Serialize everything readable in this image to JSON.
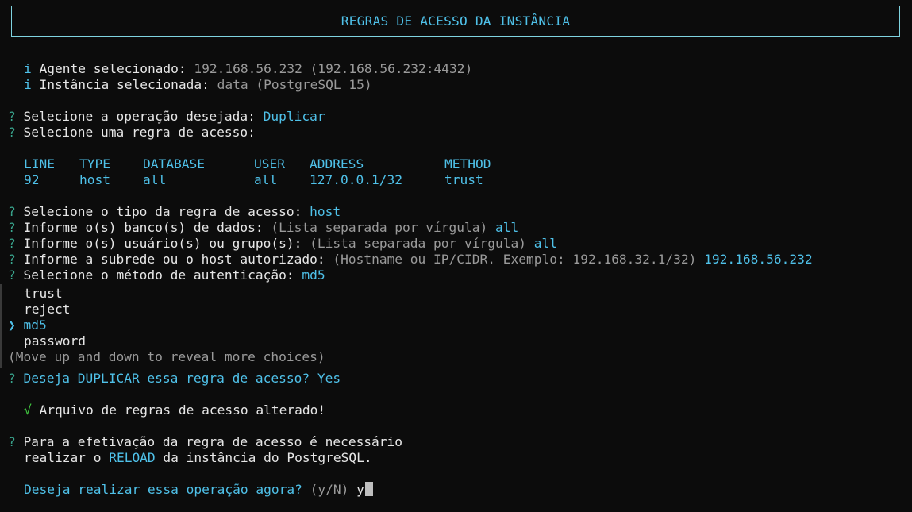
{
  "header": {
    "title": "REGRAS DE ACESSO DA INSTÂNCIA"
  },
  "info": {
    "agent_icon": "i",
    "agent_label": "Agente selecionado:",
    "agent_value": "192.168.56.232 (192.168.56.232:4432)",
    "instance_icon": "i",
    "instance_label": "Instância selecionada:",
    "instance_value": "data (PostgreSQL 15)"
  },
  "prompts": {
    "q_mark": "?",
    "operation_label": "Selecione a operação desejada:",
    "operation_value": "Duplicar",
    "rule_label": "Selecione uma regra de acesso:"
  },
  "table": {
    "columns": [
      "LINE",
      "TYPE",
      "DATABASE",
      "USER",
      "ADDRESS",
      "METHOD"
    ],
    "rows": [
      [
        "92",
        "host",
        "all",
        "all",
        "127.0.0.1/32",
        "trust"
      ]
    ]
  },
  "form": {
    "type_label": "Selecione o tipo da regra de acesso:",
    "type_value": "host",
    "db_label": "Informe o(s) banco(s) de dados:",
    "db_hint": "(Lista separada por vírgula)",
    "db_value": "all",
    "user_label": "Informe o(s) usuário(s) ou grupo(s):",
    "user_hint": "(Lista separada por vírgula)",
    "user_value": "all",
    "host_label": "Informe a subrede ou o host autorizado:",
    "host_hint": "(Hostname ou IP/CIDR. Exemplo: 192.168.32.1/32)",
    "host_value": "192.168.56.232",
    "method_label": "Selecione o método de autenticação:",
    "method_value": "md5"
  },
  "choices": {
    "pointer": "❯",
    "items": [
      "trust",
      "reject",
      "md5",
      "password"
    ],
    "selected_index": 2,
    "hint": "(Move up and down to reveal more choices)"
  },
  "confirm": {
    "duplicate_label": "Deseja DUPLICAR essa regra de acesso?",
    "duplicate_value": "Yes",
    "success_icon": "√",
    "success_text": "Arquivo de regras de acesso alterado!",
    "reload_line1": "Para a efetivação da regra de acesso é necessário",
    "reload_pre": "realizar o ",
    "reload_word": "RELOAD",
    "reload_post": " da instância do PostgreSQL.",
    "now_label": "Deseja realizar essa operação agora?",
    "now_hint": "(y/N)",
    "now_input": "y"
  },
  "colors": {
    "background": "#0c0c0c",
    "accent": "#4fc1e9",
    "question": "#3aa890",
    "success": "#3fc43f",
    "dim": "#9a9a9a"
  }
}
